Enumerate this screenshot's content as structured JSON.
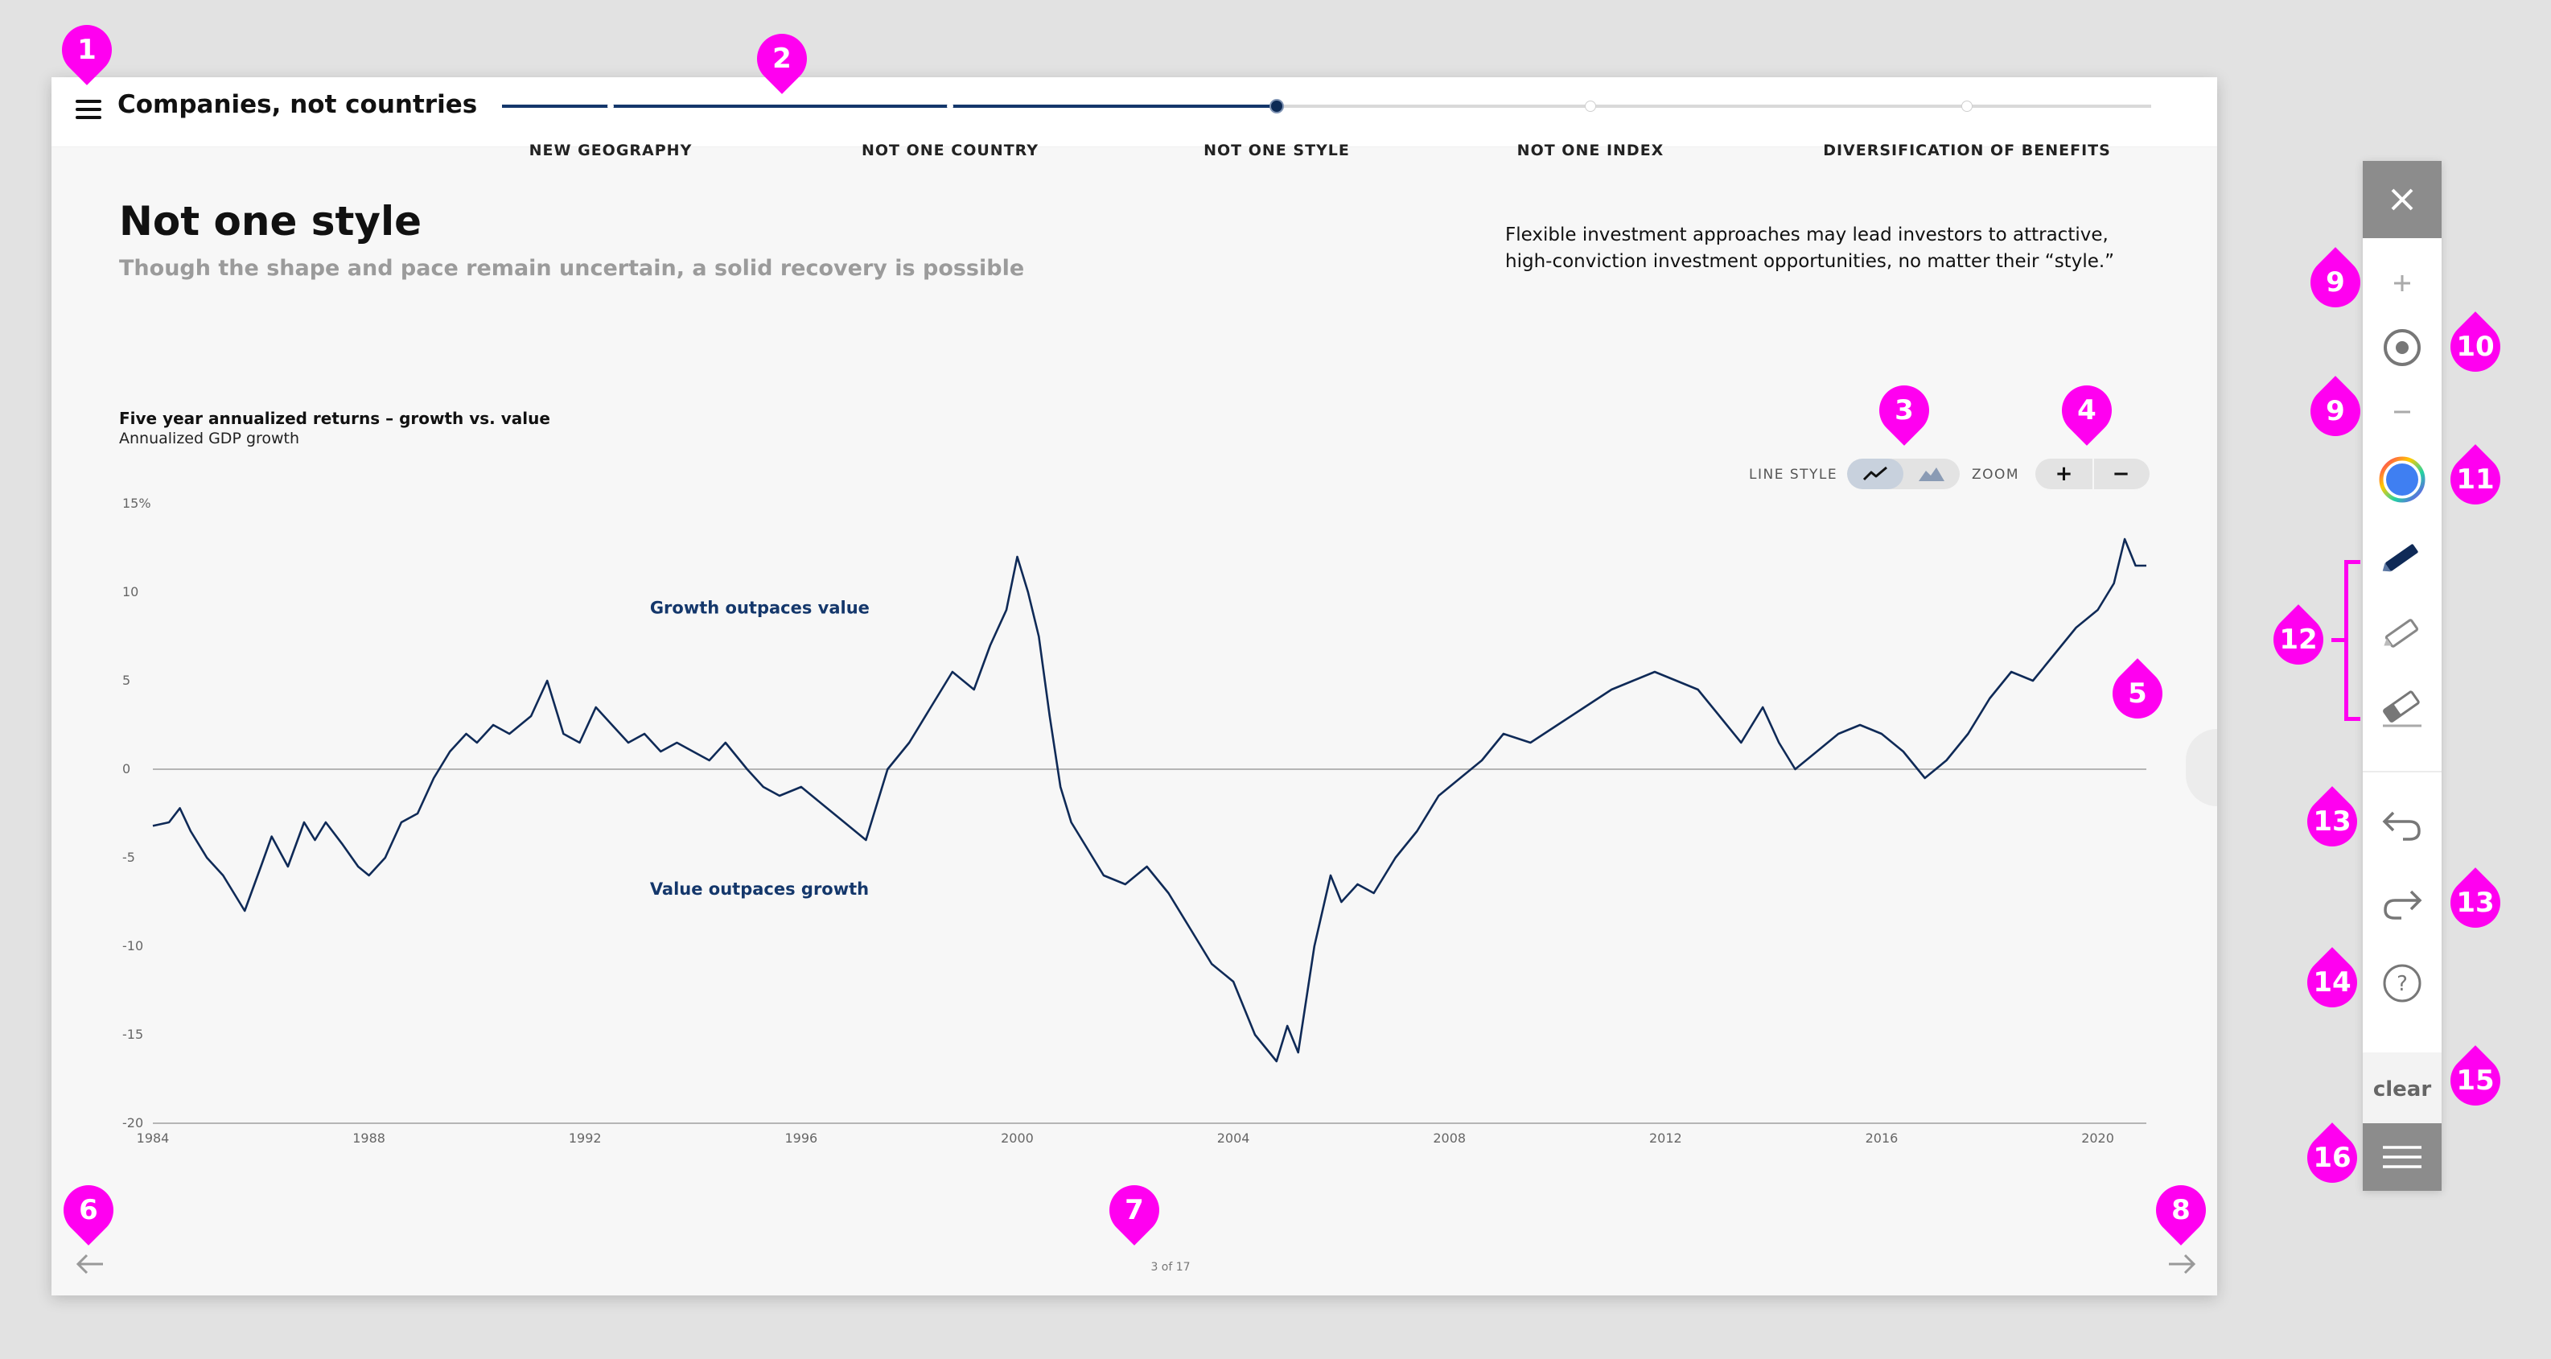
{
  "app": {
    "title": "Companies, not countries",
    "steps": [
      {
        "label": "NEW GEOGRAPHY",
        "state": "done"
      },
      {
        "label": "NOT ONE COUNTRY",
        "state": "done"
      },
      {
        "label": "NOT ONE STYLE",
        "state": "active"
      },
      {
        "label": "NOT ONE INDEX",
        "state": "upcoming"
      },
      {
        "label": "DIVERSIFICATION OF BENEFITS",
        "state": "upcoming"
      }
    ],
    "progress_fraction": 0.47
  },
  "page": {
    "heading": "Not one style",
    "subheading": "Though the shape and pace remain uncertain, a solid recovery is possible",
    "intro": "Flexible investment approaches may lead investors to attractive, high-conviction investment opportunities, no matter their “style.”",
    "counter": "3 of 17"
  },
  "controls": {
    "line_style_label": "LINE STYLE",
    "line_style_selected": "line",
    "zoom_label": "ZOOM",
    "zoom_in": "+",
    "zoom_out": "−"
  },
  "toolbar": {
    "clear_label": "clear",
    "active_color": "#3f7ff2",
    "icons": [
      "close-icon",
      "zoom-in-icon",
      "target-icon",
      "zoom-out-icon",
      "color-wheel-icon",
      "pen-icon",
      "highlighter-icon",
      "eraser-icon",
      "undo-icon",
      "redo-icon",
      "help-icon",
      "menu-icon"
    ]
  },
  "markers": [
    "1",
    "2",
    "3",
    "4",
    "5",
    "6",
    "7",
    "8",
    "9",
    "9",
    "10",
    "11",
    "12",
    "13",
    "13",
    "14",
    "15",
    "16"
  ],
  "colors": {
    "navy": "#14376b",
    "line": "#0f2a57",
    "marker": "#ff00f0"
  },
  "chart_data": {
    "type": "line",
    "title": "Five year annualized returns – growth vs. value",
    "subtitle": "Annualized GDP growth",
    "annotations": [
      "Growth outpaces value",
      "Value outpaces growth"
    ],
    "xlim": [
      1984,
      2020.9
    ],
    "ylim": [
      -20,
      15
    ],
    "x_ticks": [
      "1984",
      "1988",
      "1992",
      "1996",
      "2000",
      "2004",
      "2008",
      "2012",
      "2016",
      "2020"
    ],
    "y_ticks": [
      "15%",
      "10",
      "5",
      "0",
      "-5",
      "-10",
      "-15",
      "-20"
    ],
    "grid": false,
    "series": [
      {
        "x": [
          1984.0,
          1984.3,
          1984.5,
          1984.7,
          1985.0,
          1985.3,
          1985.7,
          1986.0,
          1986.2,
          1986.5,
          1986.8,
          1987.0,
          1987.2,
          1987.5,
          1987.8,
          1988.0,
          1988.3,
          1988.6,
          1988.9,
          1989.2,
          1989.5,
          1989.8,
          1990.0,
          1990.3,
          1990.6,
          1991.0,
          1991.3,
          1991.6,
          1991.9,
          1992.2,
          1992.5,
          1992.8,
          1993.1,
          1993.4,
          1993.7,
          1994.0,
          1994.3,
          1994.6,
          1995.0,
          1995.3,
          1995.6,
          1996.0,
          1996.4,
          1996.8,
          1997.2,
          1997.6,
          1998.0,
          1998.4,
          1998.8,
          1999.2,
          1999.5,
          1999.8,
          2000.0,
          2000.2,
          2000.4,
          2000.6,
          2000.8,
          2001.0,
          2001.3,
          2001.6,
          2002.0,
          2002.4,
          2002.8,
          2003.2,
          2003.6,
          2004.0,
          2004.4,
          2004.8,
          2005.0,
          2005.2,
          2005.5,
          2005.8,
          2006.0,
          2006.3,
          2006.6,
          2007.0,
          2007.4,
          2007.8,
          2008.2,
          2008.6,
          2009.0,
          2009.5,
          2010.0,
          2010.5,
          2011.0,
          2011.4,
          2011.8,
          2012.2,
          2012.6,
          2013.0,
          2013.4,
          2013.8,
          2014.1,
          2014.4,
          2014.8,
          2015.2,
          2015.6,
          2016.0,
          2016.4,
          2016.8,
          2017.2,
          2017.6,
          2018.0,
          2018.4,
          2018.8,
          2019.2,
          2019.6,
          2020.0,
          2020.3,
          2020.5,
          2020.7,
          2020.9
        ],
        "values": [
          -3.2,
          -3.0,
          -2.2,
          -3.5,
          -5.0,
          -6.0,
          -8.0,
          -5.5,
          -3.8,
          -5.5,
          -3.0,
          -4.0,
          -3.0,
          -4.2,
          -5.5,
          -6.0,
          -5.0,
          -3.0,
          -2.5,
          -0.5,
          1.0,
          2.0,
          1.5,
          2.5,
          2.0,
          3.0,
          5.0,
          2.0,
          1.5,
          3.5,
          2.5,
          1.5,
          2.0,
          1.0,
          1.5,
          1.0,
          0.5,
          1.5,
          0.0,
          -1.0,
          -1.5,
          -1.0,
          -2.0,
          -3.0,
          -4.0,
          0.0,
          1.5,
          3.5,
          5.5,
          4.5,
          7.0,
          9.0,
          12.0,
          10.0,
          7.5,
          3.0,
          -1.0,
          -3.0,
          -4.5,
          -6.0,
          -6.5,
          -5.5,
          -7.0,
          -9.0,
          -11.0,
          -12.0,
          -15.0,
          -16.5,
          -14.5,
          -16.0,
          -10.0,
          -6.0,
          -7.5,
          -6.5,
          -7.0,
          -5.0,
          -3.5,
          -1.5,
          -0.5,
          0.5,
          2.0,
          1.5,
          2.5,
          3.5,
          4.5,
          5.0,
          5.5,
          5.0,
          4.5,
          3.0,
          1.5,
          3.5,
          1.5,
          0.0,
          1.0,
          2.0,
          2.5,
          2.0,
          1.0,
          -0.5,
          0.5,
          2.0,
          4.0,
          5.5,
          5.0,
          6.5,
          8.0,
          9.0,
          10.5,
          13.0,
          11.5,
          11.5
        ]
      }
    ]
  }
}
